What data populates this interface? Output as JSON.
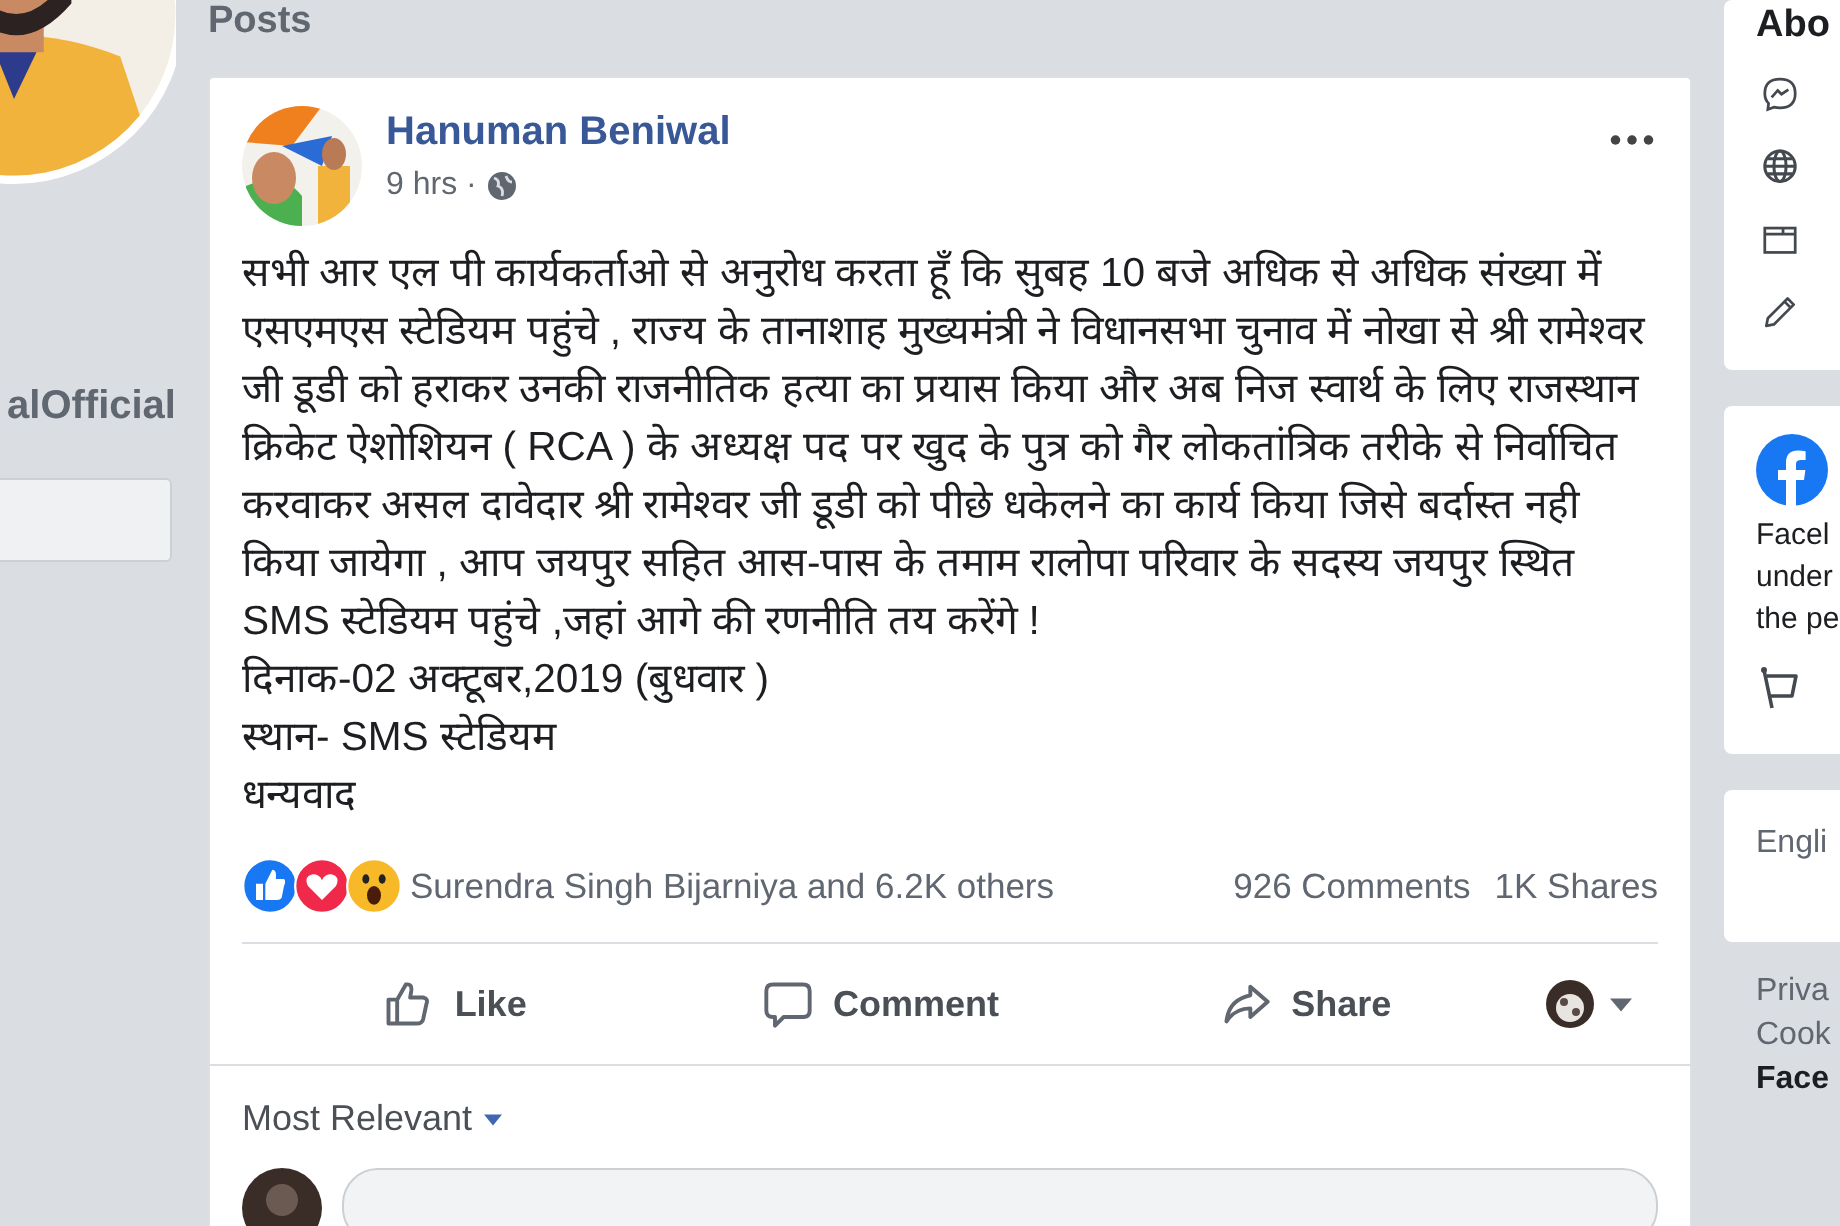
{
  "left_column": {
    "page_handle": "alOfficial"
  },
  "posts_header": "Posts",
  "post": {
    "author": "Hanuman Beniwal",
    "time": "9 hrs ·",
    "body": [
      "सभी आर एल पी कार्यकर्ताओ से अनुरोध करता हूँ कि सुबह 10 बजे अधिक से अधिक संख्या में एसएमएस स्टेडियम पहुंचे , राज्य के तानाशाह मुख्यमंत्री ने विधानसभा चुनाव में नोखा से श्री रामेश्वर जी डूडी को हराकर उनकी राजनीतिक हत्या का प्रयास किया और अब निज स्वार्थ के लिए राजस्थान क्रिकेट ऐशोशियन ( RCA ) के अध्यक्ष पद पर खुद के पुत्र को गैर लोकतांत्रिक तरीके से निर्वाचित करवाकर असल दावेदार श्री रामेश्वर जी डूडी को पीछे धकेलने का कार्य किया जिसे बर्दास्त नही किया जायेगा , आप जयपुर सहित आस-पास के तमाम रालोपा परिवार के सदस्य जयपुर स्थित SMS स्टेडियम पहुंचे ,जहां आगे की रणनीति तय करेंगे !",
      "दिनाक-02 अक्टूबर,2019 (बुधवार )",
      "स्थान- SMS स्टेडियम",
      "धन्यवाद"
    ],
    "reactions": [
      {
        "kind": "like"
      },
      {
        "kind": "love"
      },
      {
        "kind": "wow"
      }
    ],
    "reaction_summary": "Surendra Singh Bijarniya and 6.2K others",
    "comments": "926 Comments",
    "shares": "1K Shares",
    "actions": [
      {
        "kind": "like",
        "label": "Like"
      },
      {
        "kind": "comment",
        "label": "Comment"
      },
      {
        "kind": "share",
        "label": "Share"
      }
    ],
    "sort": "Most Relevant"
  },
  "right_column": {
    "about_title": "Abo",
    "about_icons": [
      {
        "kind": "messenger"
      },
      {
        "kind": "globe"
      },
      {
        "kind": "card"
      },
      {
        "kind": "pencil"
      }
    ],
    "transparency_lines": [
      "Facel",
      "under",
      "the pe"
    ],
    "language": "Engli",
    "footer_links": [
      {
        "text": "Priva",
        "bold": false
      },
      {
        "text": "Cook",
        "bold": false
      },
      {
        "text": "Face",
        "bold": true
      }
    ]
  }
}
